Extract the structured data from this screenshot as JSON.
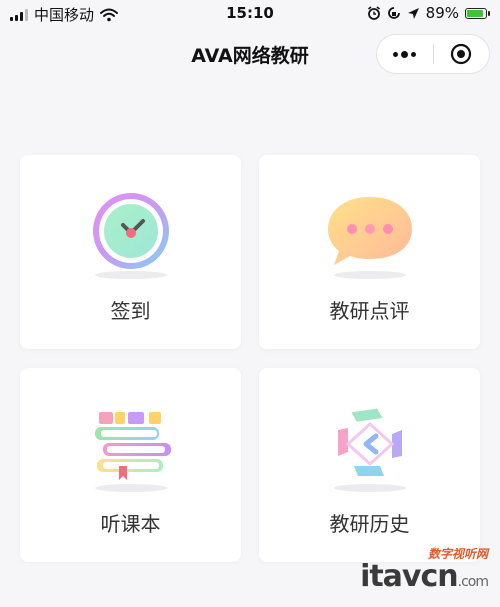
{
  "status_bar": {
    "carrier": "中国移动",
    "time": "15:10",
    "battery": "89%",
    "battery_level": 0.89,
    "icons": [
      "signal-icon",
      "wifi-icon",
      "alarm-icon",
      "rotation-lock-icon",
      "location-icon",
      "battery-icon"
    ]
  },
  "navbar": {
    "title": "AVA网络教研",
    "more_icon": "more-dots-icon",
    "close_icon": "mini-program-close-icon"
  },
  "menu": {
    "items": [
      {
        "label": "签到",
        "icon": "clock-icon"
      },
      {
        "label": "教研点评",
        "icon": "chat-bubble-icon"
      },
      {
        "label": "听课本",
        "icon": "books-icon"
      },
      {
        "label": "教研历史",
        "icon": "history-icon"
      }
    ]
  },
  "watermark": {
    "cn": "数字视听网",
    "brand": "itavcn",
    "suffix": ".com"
  }
}
